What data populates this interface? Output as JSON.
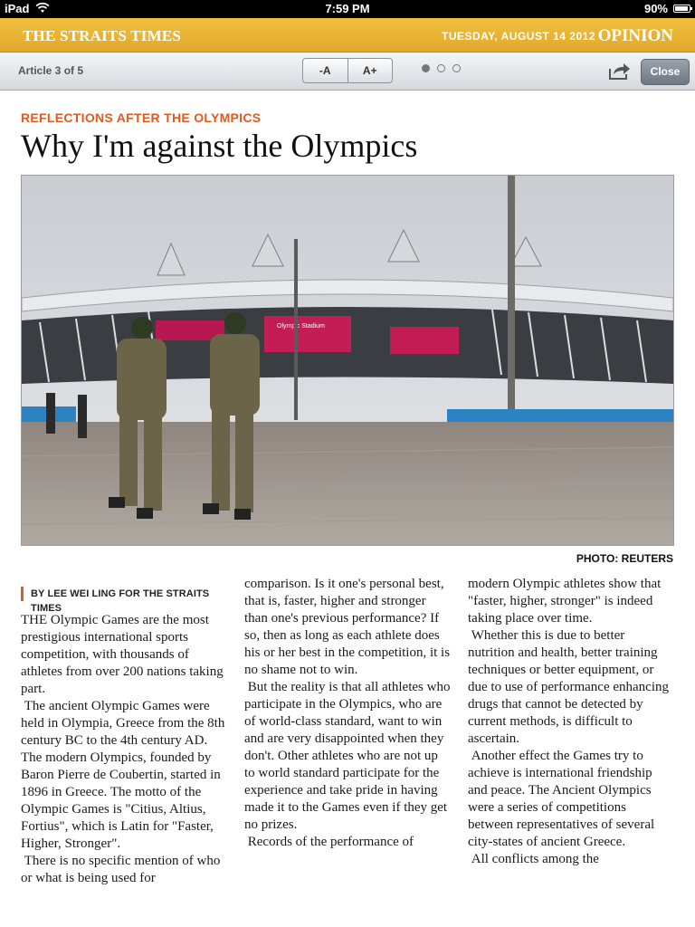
{
  "status_bar": {
    "device": "iPad",
    "time": "7:59 PM",
    "battery": "90%"
  },
  "masthead": {
    "paper": "THE STRAITS TIMES",
    "date": "TUESDAY, AUGUST 14 2012",
    "section": "OPINION"
  },
  "toolbar": {
    "counter": "Article 3 of 5",
    "font_smaller": "-A",
    "font_larger": "A+",
    "close": "Close",
    "page_dots": 3,
    "active_dot": 1
  },
  "article": {
    "kicker": "REFLECTIONS AFTER THE OLYMPICS",
    "headline": "Why I'm against the Olympics",
    "photo_credit": "PHOTO: REUTERS",
    "photo_signs": {
      "stadium": "Olympic Stadium"
    },
    "byline": "BY LEE WEI LING FOR THE STRAITS TIMES",
    "col1": [
      "THE Olympic Games are the most prestigious international sports competition, with thousands of athletes from over 200 nations taking part.",
      " The ancient Olympic Games were held in Olympia, Greece from the 8th century BC to the 4th century AD. The modern Olympics, founded by Baron Pierre de Coubertin, started in 1896 in Greece. The motto of the Olympic Games is \"Citius, Altius, Fortius\", which is Latin for \"Faster, Higher, Stronger\".",
      " There is no specific mention of who or what is being used for"
    ],
    "col2": [
      "comparison. Is it one's personal best, that is, faster, higher and stronger than one's previous performance? If so, then as long as each athlete does his or her best in the competition, it is no shame not to win.",
      " But the reality is that all athletes who participate in the Olympics, who are of world-class standard, want to win and are very disappointed when they don't. Other athletes who are not up to world standard participate for the experience and take pride in having made it to the Games even if they get no prizes.",
      " Records of the performance of"
    ],
    "col3": [
      "modern Olympic athletes show that \"faster, higher, stronger\" is indeed taking place over time.",
      " Whether this is due to better nutrition and health, better training techniques or better equipment, or due to use of performance enhancing drugs that cannot be detected by current methods, is difficult to ascertain.",
      " Another effect the Games try to achieve is international friendship and peace. The Ancient Olympics were a series of competitions between representatives of several city-states of ancient Greece.",
      " All conflicts among the"
    ]
  },
  "colors": {
    "masthead": "#e8b232",
    "kicker": "#e05a22"
  }
}
